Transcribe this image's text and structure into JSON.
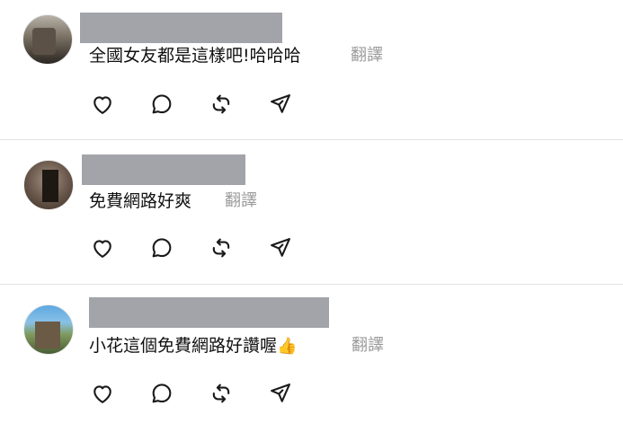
{
  "comments": [
    {
      "text": "全國女友都是這樣吧!哈哈哈",
      "translate_label": "翻譯"
    },
    {
      "text": "免費網路好爽",
      "translate_label": "翻譯"
    },
    {
      "text": "小花這個免費網路好讚喔",
      "emoji": "👍",
      "translate_label": "翻譯"
    }
  ],
  "icons": {
    "like": "heart-icon",
    "reply": "comment-bubble-icon",
    "repost": "repost-icon",
    "share": "send-icon"
  },
  "colors": {
    "text": "#111111",
    "translate": "#9a9a9a",
    "icon": "#1a1a1a",
    "divider": "#e3e3e3",
    "name_redaction": "#a3a4aa"
  }
}
